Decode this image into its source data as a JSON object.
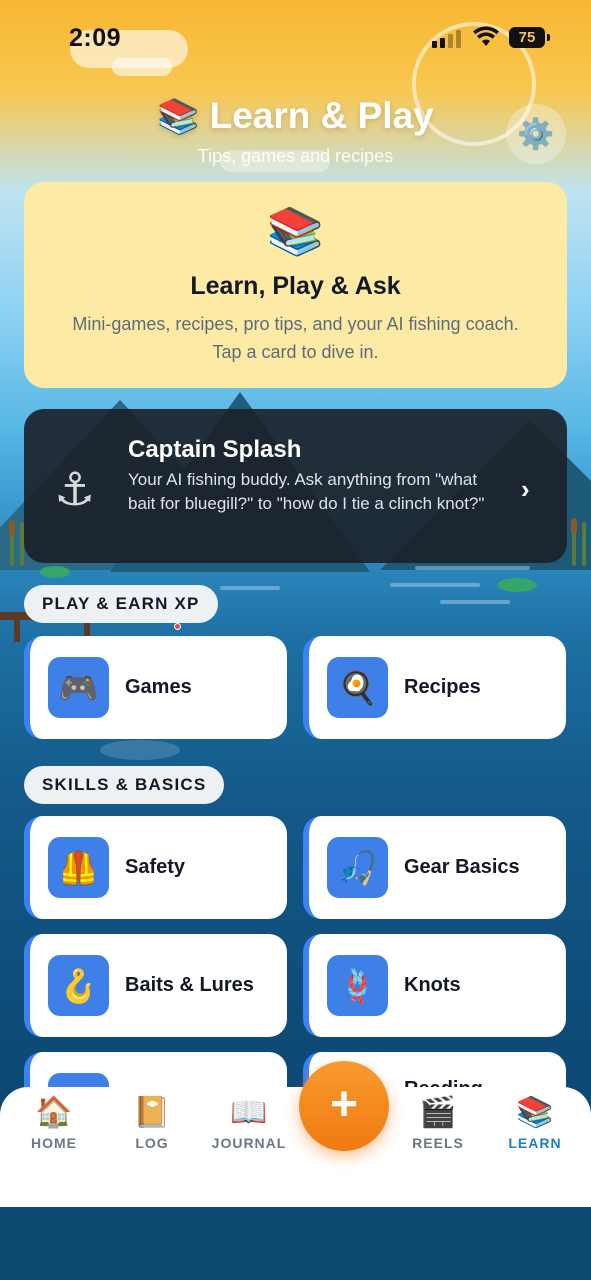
{
  "status": {
    "time": "2:09",
    "battery": "75"
  },
  "header": {
    "icon": "📚",
    "title": "Learn & Play",
    "subtitle": "Tips, games and recipes",
    "settings_icon": "⚙️"
  },
  "hero": {
    "icon": "📚",
    "title": "Learn, Play & Ask",
    "description": "Mini-games, recipes, pro tips, and your AI fishing coach. Tap a card to dive in."
  },
  "captain": {
    "icon": "⚓",
    "title": "Captain Splash",
    "description": "Your AI fishing buddy. Ask anything from \"what bait for bluegill?\" to \"how do I tie a clinch knot?\"",
    "chevron": "›"
  },
  "sections": {
    "play": {
      "label": "PLAY & EARN XP",
      "tiles": [
        {
          "icon": "🎮",
          "label": "Games"
        },
        {
          "icon": "🍳",
          "label": "Recipes"
        }
      ]
    },
    "skills": {
      "label": "SKILLS & BASICS",
      "tiles": [
        {
          "icon": "🦺",
          "label": "Safety"
        },
        {
          "icon": "🎣",
          "label": "Gear Basics"
        },
        {
          "icon": "🪝",
          "label": "Baits & Lures"
        },
        {
          "icon": "🪢",
          "label": "Knots"
        },
        {
          "icon": "",
          "label": ""
        },
        {
          "icon": "",
          "label": "Reading"
        }
      ]
    }
  },
  "nav": {
    "items": [
      {
        "icon": "🏠",
        "label": "HOME"
      },
      {
        "icon": "📔",
        "label": "LOG"
      },
      {
        "icon": "📖",
        "label": "JOURNAL"
      },
      {
        "icon": "🎬",
        "label": "REELS"
      },
      {
        "icon": "📚",
        "label": "LEARN"
      }
    ],
    "fab": "+"
  },
  "colors": {
    "accent": "#3b82f6",
    "fab": "#f08a1c",
    "active_nav": "#1b7fc4"
  }
}
